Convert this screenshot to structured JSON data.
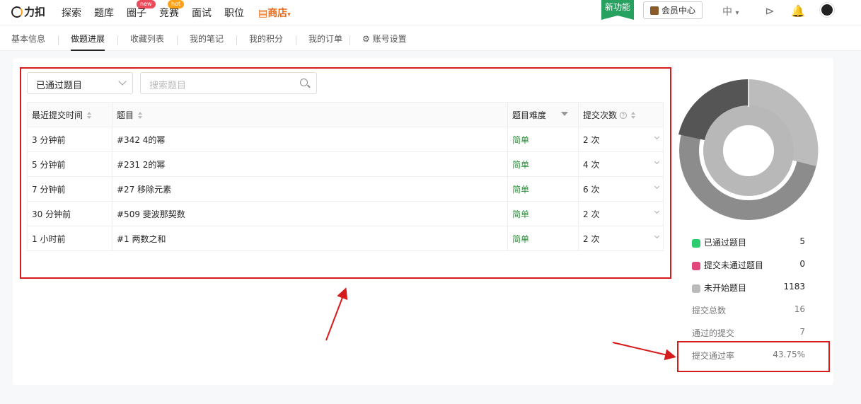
{
  "nav": {
    "logo_text": "力扣",
    "items": [
      {
        "label": "探索"
      },
      {
        "label": "题库"
      },
      {
        "label": "圈子",
        "badge": "new"
      },
      {
        "label": "竞赛",
        "badge": "hot"
      },
      {
        "label": "面试"
      },
      {
        "label": "职位"
      },
      {
        "label": "商店"
      }
    ],
    "new_feature": "新功能",
    "vip": "会员中心",
    "lang": "中"
  },
  "subnav": {
    "tabs": [
      "基本信息",
      "做题进展",
      "收藏列表",
      "我的笔记",
      "我的积分",
      "我的订单",
      "账号设置"
    ],
    "active": 1
  },
  "filter": {
    "select_value": "已通过题目",
    "search_placeholder": "搜索题目"
  },
  "table": {
    "headers": [
      "最近提交时间",
      "题目",
      "题目难度",
      "提交次数"
    ],
    "rows": [
      {
        "time": "3 分钟前",
        "problem": "#342 4的幂",
        "difficulty": "简单",
        "count": "2 次"
      },
      {
        "time": "5 分钟前",
        "problem": "#231 2的幂",
        "difficulty": "简单",
        "count": "4 次"
      },
      {
        "time": "7 分钟前",
        "problem": "#27 移除元素",
        "difficulty": "简单",
        "count": "6 次"
      },
      {
        "time": "30 分钟前",
        "problem": "#509 斐波那契数",
        "difficulty": "简单",
        "count": "2 次"
      },
      {
        "time": "1 小时前",
        "problem": "#1 两数之和",
        "difficulty": "简单",
        "count": "2 次"
      }
    ]
  },
  "stats": {
    "legend": [
      {
        "label": "已通过题目",
        "value": "5",
        "color": "#2ecc71"
      },
      {
        "label": "提交未通过题目",
        "value": "0",
        "color": "#e0457b"
      },
      {
        "label": "未开始题目",
        "value": "1183",
        "color": "#bbbbbb"
      }
    ],
    "totals": [
      {
        "label": "提交总数",
        "value": "16"
      },
      {
        "label": "通过的提交",
        "value": "7"
      },
      {
        "label": "提交通过率",
        "value": "43.75%"
      }
    ]
  },
  "colors": {
    "accent": "#ffa116",
    "easy": "#2b8f3a",
    "annotation": "#d51b1b"
  }
}
